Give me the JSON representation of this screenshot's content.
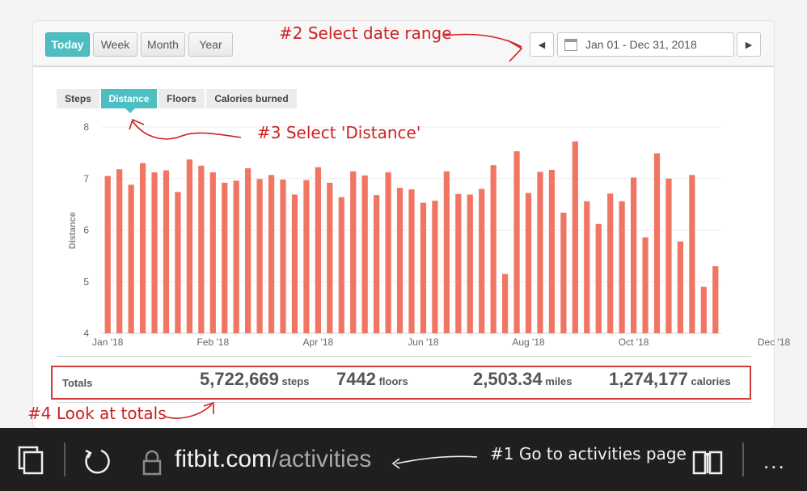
{
  "range_buttons": [
    "Today",
    "Week",
    "Month",
    "Year"
  ],
  "active_range": "Today",
  "date_range": "Jan 01 - Dec 31, 2018",
  "metric_tabs": [
    "Steps",
    "Distance",
    "Floors",
    "Calories burned"
  ],
  "active_metric": "Distance",
  "annotations": {
    "a1": "#1 Go to activities page",
    "a2": "#2 Select date range",
    "a3": "#3 Select 'Distance'",
    "a4": "#4 Look at totals"
  },
  "totals": {
    "label": "Totals",
    "steps_value": "5,722,669",
    "steps_unit": "steps",
    "floors_value": "7442",
    "floors_unit": "floors",
    "miles_value": "2,503.34",
    "miles_unit": "miles",
    "calories_value": "1,274,177",
    "calories_unit": "calories"
  },
  "browser": {
    "url_domain": "fitbit.com",
    "url_path": "/activities",
    "more_label": "..."
  },
  "colors": {
    "accent": "#4dbfc2",
    "bar": "#f07563",
    "annotation": "#cc2222"
  },
  "icons": [
    "prev-arrow-icon",
    "next-arrow-icon",
    "calendar-icon",
    "tabs-icon",
    "refresh-icon",
    "lock-icon",
    "reading-view-icon"
  ],
  "chart_data": {
    "type": "bar",
    "ylabel": "Distance",
    "ylim": [
      4,
      8
    ],
    "yticks": [
      4,
      5,
      6,
      7,
      8
    ],
    "xtick_labels": [
      {
        "label": "Jan '18",
        "index": 0
      },
      {
        "label": "Feb '18",
        "index": 9
      },
      {
        "label": "Apr '18",
        "index": 18
      },
      {
        "label": "Jun '18",
        "index": 27
      },
      {
        "label": "Aug '18",
        "index": 36
      },
      {
        "label": "Oct '18",
        "index": 45
      },
      {
        "label": "Dec '18",
        "index": 57
      }
    ],
    "values": [
      7.05,
      7.18,
      6.88,
      7.3,
      7.12,
      7.16,
      6.74,
      7.37,
      7.25,
      7.12,
      6.92,
      6.96,
      7.2,
      6.99,
      7.07,
      6.98,
      6.69,
      6.97,
      7.22,
      6.92,
      6.64,
      7.14,
      7.06,
      6.68,
      7.12,
      6.82,
      6.79,
      6.53,
      6.57,
      7.14,
      6.7,
      6.69,
      6.8,
      7.26,
      5.15,
      7.53,
      6.72,
      7.13,
      7.17,
      6.34,
      7.72,
      6.56,
      6.12,
      6.71,
      6.56,
      7.02,
      5.86,
      7.49,
      7.0,
      5.78,
      7.07,
      4.9,
      5.3
    ]
  }
}
